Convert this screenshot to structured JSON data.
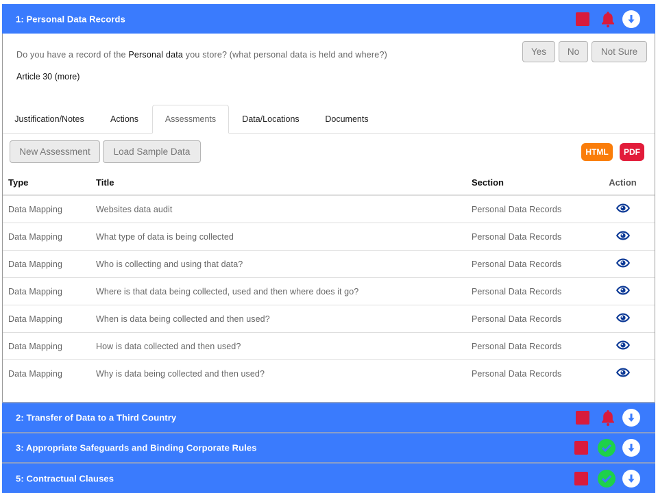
{
  "colors": {
    "header_bg": "#3a7bfd",
    "status_red": "#d81b3c",
    "status_green": "#1ed14a",
    "html_button": "#fa7d0a",
    "pdf_button": "#e21c3a",
    "eye_icon": "#0d3a96"
  },
  "sections": [
    {
      "title": "1: Personal Data Records",
      "status_icon": "bell-icon",
      "expanded": true
    },
    {
      "title": "2: Transfer of Data to a Third Country",
      "status_icon": "bell-icon",
      "expanded": false
    },
    {
      "title": "3: Appropriate Safeguards and Binding Corporate Rules",
      "status_icon": "check-circle-icon",
      "expanded": false
    },
    {
      "title": "5: Contractual Clauses",
      "status_icon": "check-circle-icon",
      "expanded": false
    }
  ],
  "question": {
    "prefix": "Do you have a record of the ",
    "emphasis": "Personal data",
    "suffix": " you store? (what personal data is held and where?)",
    "article_link": "Article 30 (more)",
    "answers": [
      "Yes",
      "No",
      "Not Sure"
    ]
  },
  "tabs": [
    {
      "label": "Justification/Notes",
      "active": false
    },
    {
      "label": "Actions",
      "active": false
    },
    {
      "label": "Assessments",
      "active": true
    },
    {
      "label": "Data/Locations",
      "active": false
    },
    {
      "label": "Documents",
      "active": false
    }
  ],
  "toolbar": {
    "new_assessment": "New Assessment",
    "load_sample": "Load Sample Data",
    "html_export": "HTML",
    "pdf_export": "PDF"
  },
  "table": {
    "headers": [
      "Type",
      "Title",
      "Section",
      "Action"
    ],
    "rows": [
      {
        "type": "Data Mapping",
        "title": "Websites data audit",
        "section": "Personal Data Records",
        "action": "eye-icon"
      },
      {
        "type": "Data Mapping",
        "title": "What type of data is being collected",
        "section": "Personal Data Records",
        "action": "eye-icon"
      },
      {
        "type": "Data Mapping",
        "title": "Who is collecting and using that data?",
        "section": "Personal Data Records",
        "action": "eye-icon"
      },
      {
        "type": "Data Mapping",
        "title": "Where is that data being collected, used and then where does it go?",
        "section": "Personal Data Records",
        "action": "eye-icon"
      },
      {
        "type": "Data Mapping",
        "title": "When is data being collected and then used?",
        "section": "Personal Data Records",
        "action": "eye-icon"
      },
      {
        "type": "Data Mapping",
        "title": "How is data collected and then used?",
        "section": "Personal Data Records",
        "action": "eye-icon"
      },
      {
        "type": "Data Mapping",
        "title": "Why is data being collected and then used?",
        "section": "Personal Data Records",
        "action": "eye-icon"
      }
    ]
  }
}
